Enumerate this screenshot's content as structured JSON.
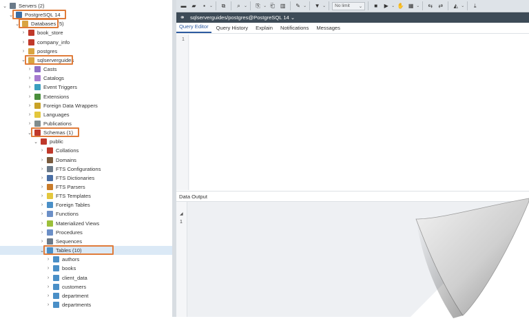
{
  "tree": {
    "items": [
      {
        "label": "Servers (2)",
        "icon": "server-group-icon",
        "color": "#6b7a89",
        "level": 0,
        "expand": "open"
      },
      {
        "label": "PostgreSQL 14",
        "icon": "server-icon",
        "color": "#3b6ea5",
        "level": 1,
        "expand": "open"
      },
      {
        "label": "Databases (5)",
        "icon": "databases-icon",
        "color": "#d9a441",
        "level": 2,
        "expand": "open"
      },
      {
        "label": "book_store",
        "icon": "database-icon",
        "color": "#c0392b",
        "level": 3,
        "expand": "closed"
      },
      {
        "label": "company_info",
        "icon": "database-icon",
        "color": "#c0392b",
        "level": 3,
        "expand": "closed"
      },
      {
        "label": "postgres",
        "icon": "database-icon",
        "color": "#d9a441",
        "level": 3,
        "expand": "closed"
      },
      {
        "label": "sqlserverguides",
        "icon": "database-icon",
        "color": "#d9a441",
        "level": 3,
        "expand": "open"
      },
      {
        "label": "Casts",
        "icon": "casts-icon",
        "color": "#8e6fc7",
        "level": 4,
        "expand": "closed"
      },
      {
        "label": "Catalogs",
        "icon": "catalogs-icon",
        "color": "#a77bd0",
        "level": 4,
        "expand": "closed"
      },
      {
        "label": "Event Triggers",
        "icon": "event-triggers-icon",
        "color": "#3a9fbf",
        "level": 4,
        "expand": "closed"
      },
      {
        "label": "Extensions",
        "icon": "extensions-icon",
        "color": "#4a8f3c",
        "level": 4,
        "expand": "closed"
      },
      {
        "label": "Foreign Data Wrappers",
        "icon": "fdw-icon",
        "color": "#c9a227",
        "level": 4,
        "expand": "closed"
      },
      {
        "label": "Languages",
        "icon": "languages-icon",
        "color": "#e3c73d",
        "level": 4,
        "expand": "closed"
      },
      {
        "label": "Publications",
        "icon": "publications-icon",
        "color": "#7f8c8d",
        "level": 4,
        "expand": "closed"
      },
      {
        "label": "Schemas (1)",
        "icon": "schemas-icon",
        "color": "#c0392b",
        "level": 4,
        "expand": "open"
      },
      {
        "label": "public",
        "icon": "schema-icon",
        "color": "#c0392b",
        "level": 5,
        "expand": "open"
      },
      {
        "label": "Collations",
        "icon": "collations-icon",
        "color": "#c0392b",
        "level": 6,
        "expand": "closed"
      },
      {
        "label": "Domains",
        "icon": "domains-icon",
        "color": "#7a5c3e",
        "level": 6,
        "expand": "closed"
      },
      {
        "label": "FTS Configurations",
        "icon": "fts-configurations-icon",
        "color": "#6b7a89",
        "level": 6,
        "expand": "closed"
      },
      {
        "label": "FTS Dictionaries",
        "icon": "fts-dictionaries-icon",
        "color": "#4a6fa5",
        "level": 6,
        "expand": "closed"
      },
      {
        "label": "FTS Parsers",
        "icon": "fts-parsers-icon",
        "color": "#c97b2a",
        "level": 6,
        "expand": "closed"
      },
      {
        "label": "FTS Templates",
        "icon": "fts-templates-icon",
        "color": "#e3c73d",
        "level": 6,
        "expand": "closed"
      },
      {
        "label": "Foreign Tables",
        "icon": "foreign-tables-icon",
        "color": "#4a8fc7",
        "level": 6,
        "expand": "closed"
      },
      {
        "label": "Functions",
        "icon": "functions-icon",
        "color": "#6b8fc7",
        "level": 6,
        "expand": "closed"
      },
      {
        "label": "Materialized Views",
        "icon": "materialized-views-icon",
        "color": "#9bbf3a",
        "level": 6,
        "expand": "closed"
      },
      {
        "label": "Procedures",
        "icon": "procedures-icon",
        "color": "#6b8fc7",
        "level": 6,
        "expand": "closed"
      },
      {
        "label": "Sequences",
        "icon": "sequences-icon",
        "color": "#6b7a89",
        "level": 6,
        "expand": "closed"
      },
      {
        "label": "Tables (10)",
        "icon": "tables-icon",
        "color": "#4a8fc7",
        "level": 6,
        "expand": "open",
        "selected": true
      },
      {
        "label": "authors",
        "icon": "table-icon",
        "color": "#4a8fc7",
        "level": 7,
        "expand": "closed"
      },
      {
        "label": "books",
        "icon": "table-icon",
        "color": "#4a8fc7",
        "level": 7,
        "expand": "closed"
      },
      {
        "label": "client_data",
        "icon": "table-icon",
        "color": "#4a8fc7",
        "level": 7,
        "expand": "closed"
      },
      {
        "label": "customers",
        "icon": "table-icon",
        "color": "#4a8fc7",
        "level": 7,
        "expand": "closed"
      },
      {
        "label": "department",
        "icon": "table-icon",
        "color": "#4a8fc7",
        "level": 7,
        "expand": "closed"
      },
      {
        "label": "departments",
        "icon": "table-icon",
        "color": "#4a8fc7",
        "level": 7,
        "expand": "closed"
      }
    ]
  },
  "toolbar": {
    "limit_label": "No limit"
  },
  "connection": {
    "label": "sqlserverguides/postgres@PostgreSQL 14 ⌄"
  },
  "tabs": [
    "Query Editor",
    "Query History",
    "Explain",
    "Notifications",
    "Messages"
  ],
  "editor": {
    "line_number": "1"
  },
  "output": {
    "title": "Data Output",
    "row_number": "1"
  },
  "colors": {
    "highlight": "#e07b39",
    "selected_row": "#dbe9f6",
    "active_tab": "#2c5aa0",
    "connection_bar": "#3d4b57"
  }
}
